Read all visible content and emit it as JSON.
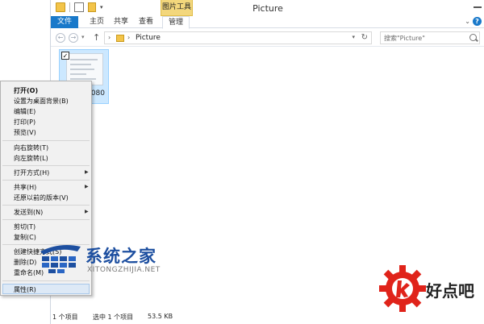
{
  "window": {
    "title": "Picture",
    "context_tab_group": "图片工具"
  },
  "ribbon": {
    "tabs": [
      "文件",
      "主页",
      "共享",
      "查看",
      "管理"
    ]
  },
  "navigation": {
    "address_crumb": "Picture",
    "search_placeholder": "搜索\"Picture\""
  },
  "content": {
    "item_label": "_080"
  },
  "context_menu": {
    "items": [
      "打开(O)",
      "设置为桌面背景(B)",
      "编辑(E)",
      "打印(P)",
      "预览(V)",
      "向右旋转(T)",
      "向左旋转(L)",
      "打开方式(H)",
      "共享(H)",
      "还原以前的版本(V)",
      "发送到(N)",
      "剪切(T)",
      "复制(C)",
      "创建快捷方式(S)",
      "删除(D)",
      "重命名(M)",
      "属性(R)"
    ]
  },
  "status_bar": {
    "count": "1 个项目",
    "selected": "选中 1 个项目",
    "size": "53.5 KB"
  },
  "watermarks": {
    "site_name": "系统之家",
    "site_url": "XITONGZHIJIA.NET",
    "brand": "好点吧"
  },
  "icons": {
    "back": "arrow-left-icon",
    "forward": "arrow-right-icon",
    "up": "arrow-up-icon",
    "refresh": "refresh-icon",
    "search": "search-icon",
    "help": "help-icon"
  },
  "colors": {
    "file_tab": "#1979ca",
    "context_tab": "#f3d77c",
    "selection": "#cce8ff",
    "menu_hover": "#dde9f6",
    "watermark_blue": "#1d4fa0",
    "watermark_red": "#e0231a"
  }
}
